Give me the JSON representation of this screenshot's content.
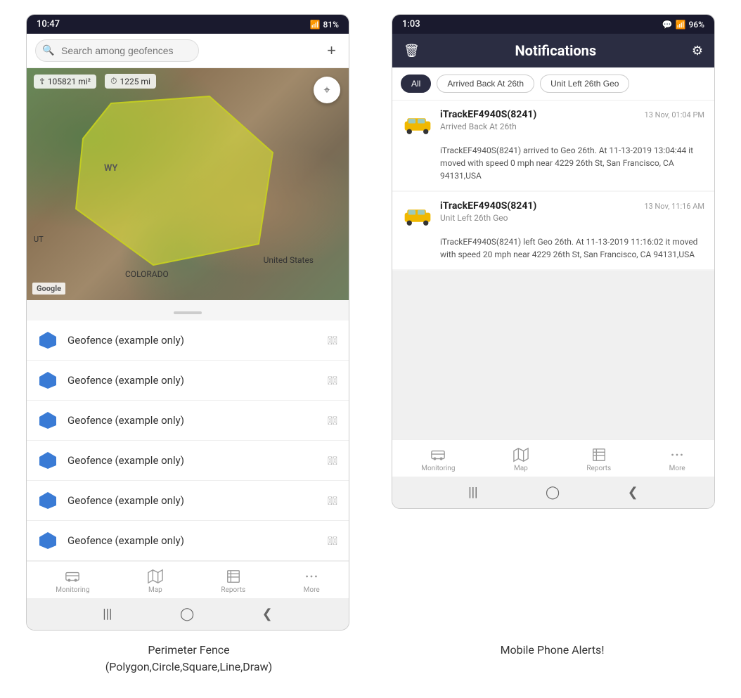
{
  "left_phone": {
    "status_bar": {
      "time": "10:47",
      "battery": "81%",
      "signal": "WiFi"
    },
    "search": {
      "placeholder": "Search among geofences"
    },
    "map": {
      "stat1": "105821 mi²",
      "stat2": "1225 mi",
      "label_wy": "WY",
      "label_us": "United States",
      "label_co": "COLORADO",
      "label_ut": "UT",
      "google": "Google"
    },
    "geofence_items": [
      "Geofence (example only)",
      "Geofence (example only)",
      "Geofence (example only)",
      "Geofence (example only)",
      "Geofence (example only)",
      "Geofence (example only)"
    ],
    "bottom_nav": [
      {
        "label": "Monitoring",
        "icon": "bus"
      },
      {
        "label": "Map",
        "icon": "map"
      },
      {
        "label": "Reports",
        "icon": "table"
      },
      {
        "label": "More",
        "icon": "more"
      }
    ]
  },
  "right_phone": {
    "status_bar": {
      "time": "1:03",
      "battery": "96%"
    },
    "header": {
      "title": "Notifications"
    },
    "filters": [
      "All",
      "Arrived Back At 26th",
      "Unit Left 26th Geo"
    ],
    "active_filter": "All",
    "notifications": [
      {
        "device": "iTrackEF4940S(8241)",
        "time": "13 Nov, 01:04 PM",
        "event": "Arrived Back At 26th",
        "body": "iTrackEF4940S(8241) arrived to Geo 26th.   At 11-13-2019 13:04:44 it moved with speed 0 mph near 4229 26th St, San Francisco, CA 94131,USA"
      },
      {
        "device": "iTrackEF4940S(8241)",
        "time": "13 Nov, 11:16 AM",
        "event": "Unit Left 26th Geo",
        "body": "iTrackEF4940S(8241) left Geo 26th.   At 11-13-2019 11:16:02 it moved with speed 20 mph near 4229 26th St, San Francisco, CA 94131,USA"
      }
    ],
    "bottom_nav": [
      {
        "label": "Monitoring",
        "icon": "bus"
      },
      {
        "label": "Map",
        "icon": "map"
      },
      {
        "label": "Reports",
        "icon": "table"
      },
      {
        "label": "More",
        "icon": "more"
      }
    ]
  },
  "captions": {
    "left": "Perimeter Fence\n(Polygon,Circle,Square,Line,Draw)",
    "right": "Mobile Phone Alerts!"
  }
}
